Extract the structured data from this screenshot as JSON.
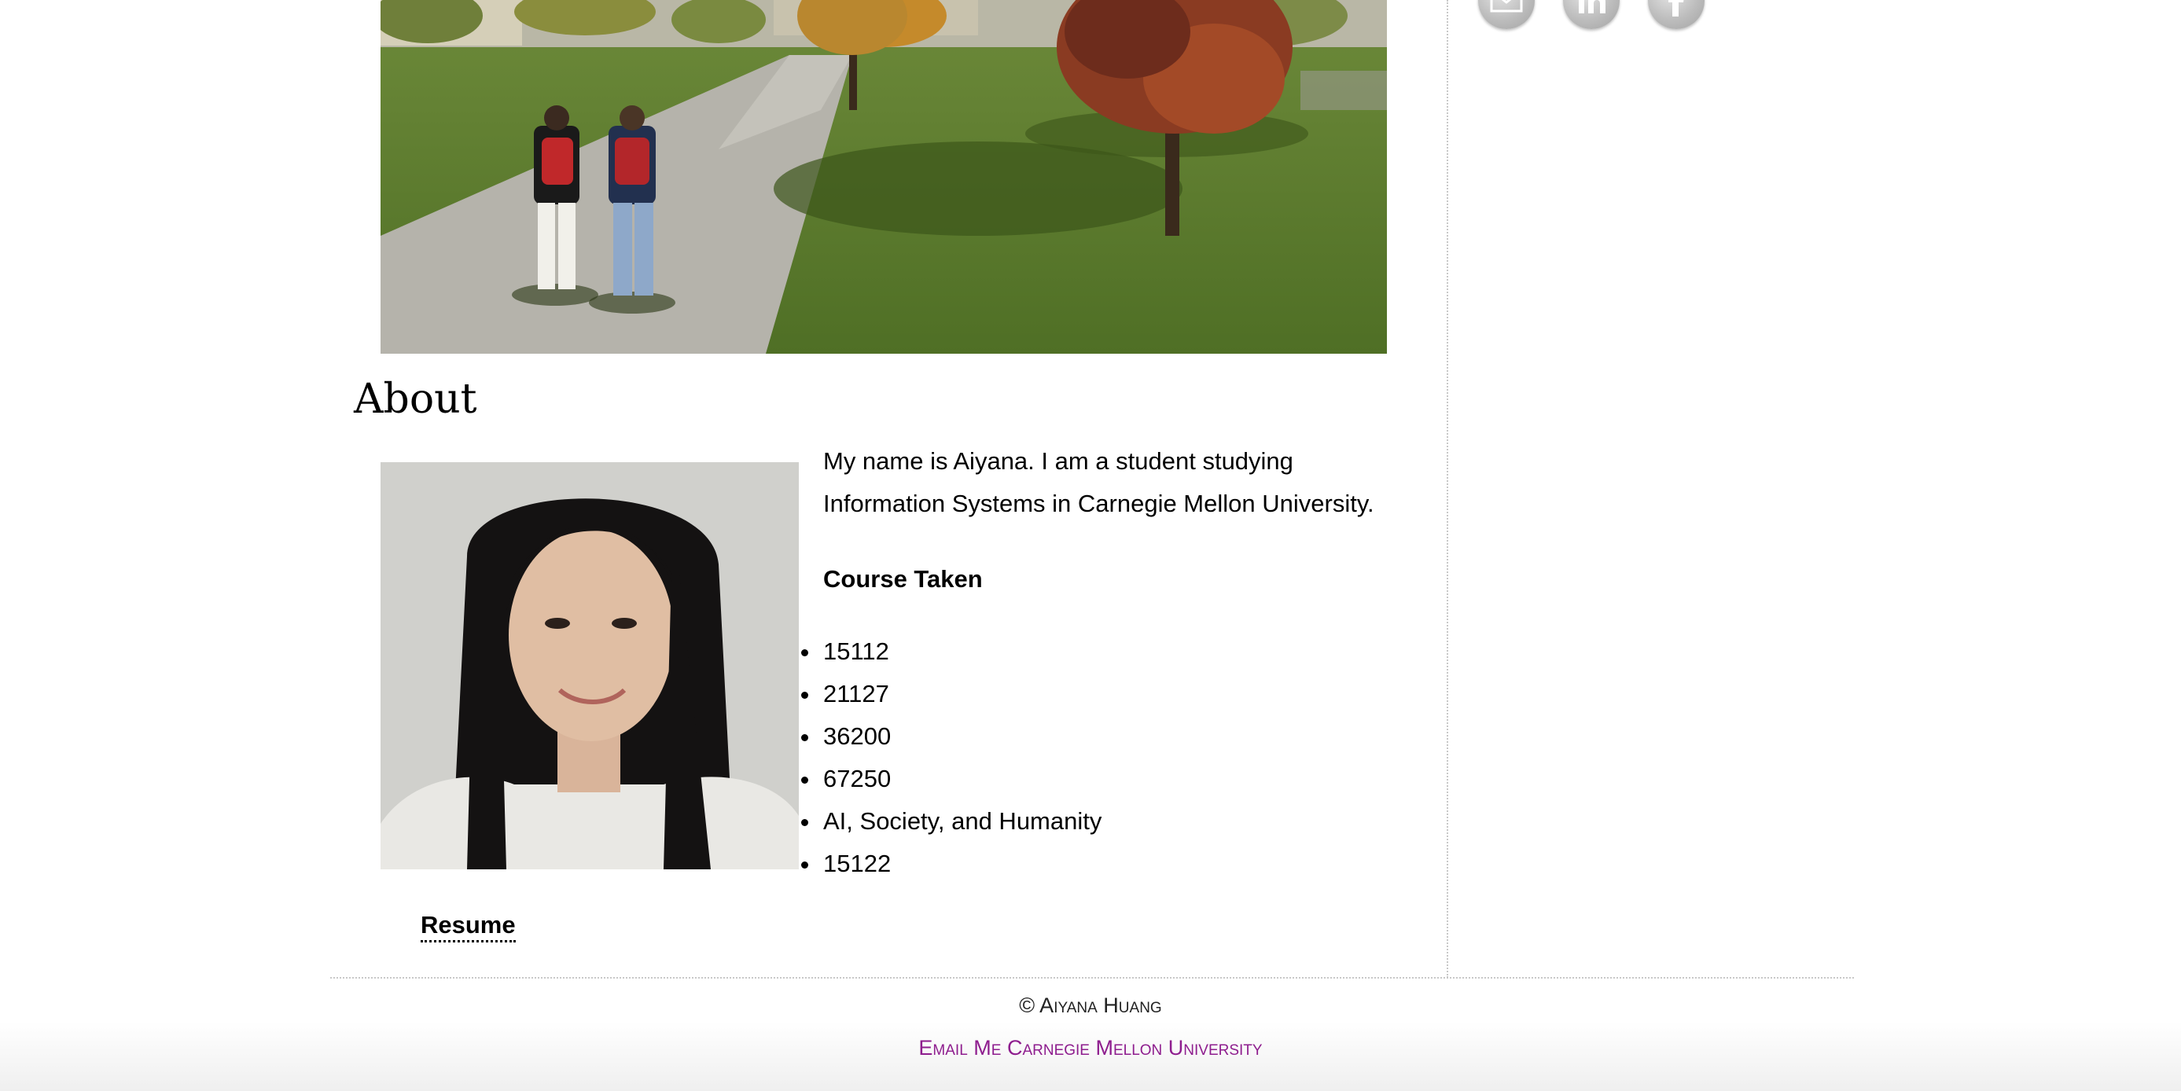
{
  "social": {
    "icons": [
      "email-icon",
      "linkedin-icon",
      "facebook-icon"
    ]
  },
  "about": {
    "heading": "About",
    "intro": "My name is Aiyana. I am a student studying Information Systems in Carnegie Mellon University.",
    "course_heading": "Course Taken",
    "courses": [
      "15112",
      "21127",
      "36200",
      "67250",
      "AI, Society, and Humanity",
      "15122"
    ],
    "resume_label": "Resume"
  },
  "footer": {
    "copyright": "© Aiyana Huang",
    "email_link": "Email Me",
    "university_link": "Carnegie Mellon University"
  },
  "colors": {
    "footer_link": "#8e1d8e",
    "divider": "#c8c8c8"
  }
}
